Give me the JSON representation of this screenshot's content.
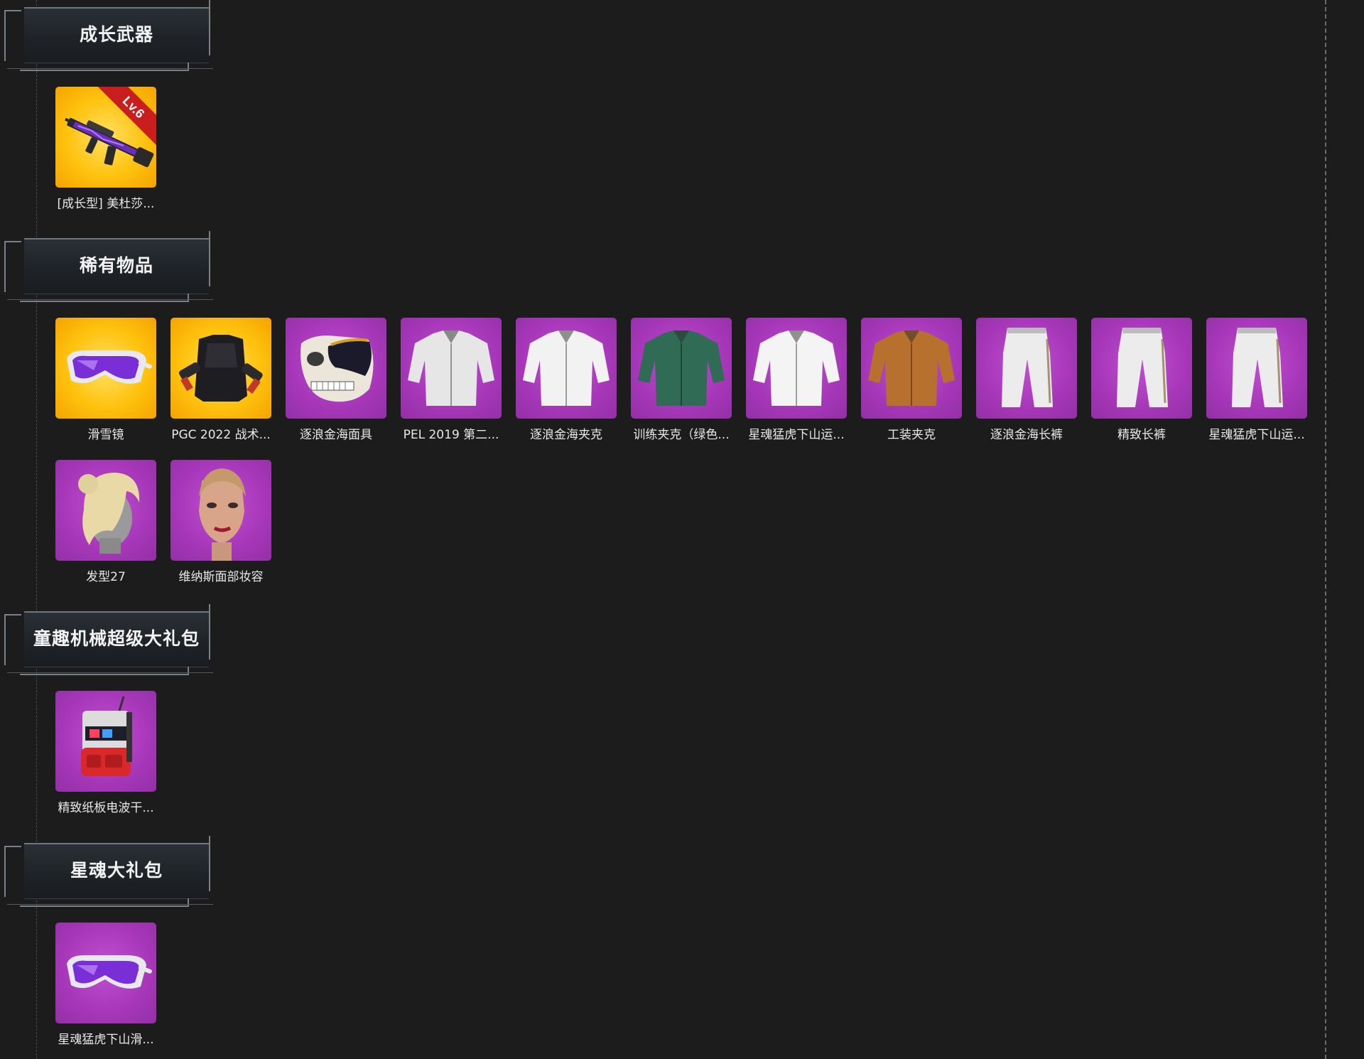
{
  "sections": [
    {
      "title": "成长武器",
      "items": [
        {
          "label": "[成长型] 美杜莎...",
          "rarity": "gold",
          "icon": "rifle-icon",
          "badge": "Lv.6"
        }
      ]
    },
    {
      "title": "稀有物品",
      "items": [
        {
          "label": "滑雪镜",
          "rarity": "gold",
          "icon": "goggles-icon"
        },
        {
          "label": "PGC 2022 战术...",
          "rarity": "gold",
          "icon": "tactical-vest-icon"
        },
        {
          "label": "逐浪金海面具",
          "rarity": "purple",
          "icon": "skull-mask-icon"
        },
        {
          "label": "PEL 2019 第二...",
          "rarity": "purple",
          "icon": "jacket-icon"
        },
        {
          "label": "逐浪金海夹克",
          "rarity": "purple",
          "icon": "jacket-icon"
        },
        {
          "label": "训练夹克（绿色...",
          "rarity": "purple",
          "icon": "jacket-icon"
        },
        {
          "label": "星魂猛虎下山运...",
          "rarity": "purple",
          "icon": "jacket-icon"
        },
        {
          "label": "工装夹克",
          "rarity": "purple",
          "icon": "jacket-icon"
        },
        {
          "label": "逐浪金海长裤",
          "rarity": "purple",
          "icon": "pants-icon"
        },
        {
          "label": "精致长裤",
          "rarity": "purple",
          "icon": "pants-icon"
        },
        {
          "label": "星魂猛虎下山运...",
          "rarity": "purple",
          "icon": "pants-icon"
        },
        {
          "label": "发型27",
          "rarity": "purple",
          "icon": "hair-icon"
        },
        {
          "label": "维纳斯面部妆容",
          "rarity": "purple",
          "icon": "face-icon"
        }
      ]
    },
    {
      "title": "童趣机械超级大礼包",
      "items": [
        {
          "label": "精致纸板电波干...",
          "rarity": "purple",
          "icon": "backpack-icon"
        }
      ]
    },
    {
      "title": "星魂大礼包",
      "items": [
        {
          "label": "星魂猛虎下山滑...",
          "rarity": "purple",
          "icon": "goggles-icon"
        }
      ]
    }
  ],
  "colors": {
    "background": "#1c1c1d",
    "gold": "#ffc20e",
    "purple": "#a637b8",
    "badge": "#c81e1e"
  }
}
